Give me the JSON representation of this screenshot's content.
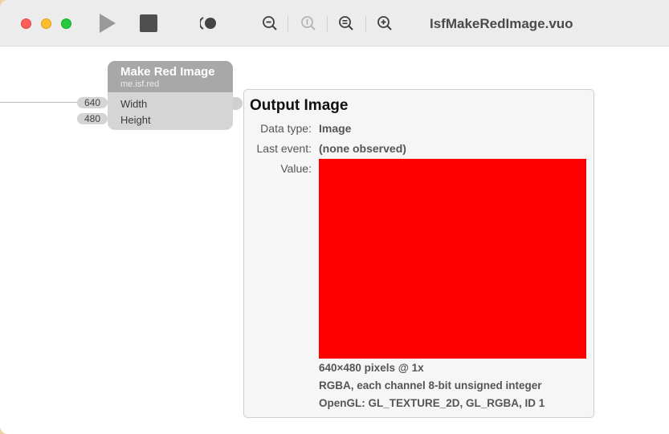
{
  "window": {
    "title": "IsfMakeRedImage.vuo"
  },
  "toolbar": {
    "run_icon": "play-icon",
    "stop_icon": "stop-icon",
    "show_events_icon": "show-events-icon",
    "zoom_out_icon": "zoom-out-icon",
    "zoom_actual_icon": "zoom-actual-size-icon",
    "zoom_fit_icon": "zoom-to-fit-icon",
    "zoom_in_icon": "zoom-in-icon"
  },
  "node": {
    "title": "Make Red Image",
    "class_name": "me.isf.red",
    "ports": [
      {
        "label": "Width",
        "value": "640"
      },
      {
        "label": "Height",
        "value": "480"
      }
    ]
  },
  "popover": {
    "title": "Output Image",
    "data_type_label": "Data type:",
    "data_type_value": "Image",
    "last_event_label": "Last event:",
    "last_event_value": "(none observed)",
    "value_label": "Value:",
    "image_color": "#ff0000",
    "info": [
      "640×480 pixels @ 1x",
      "RGBA, each channel 8-bit unsigned integer",
      "OpenGL: GL_TEXTURE_2D, GL_RGBA, ID 1"
    ]
  }
}
